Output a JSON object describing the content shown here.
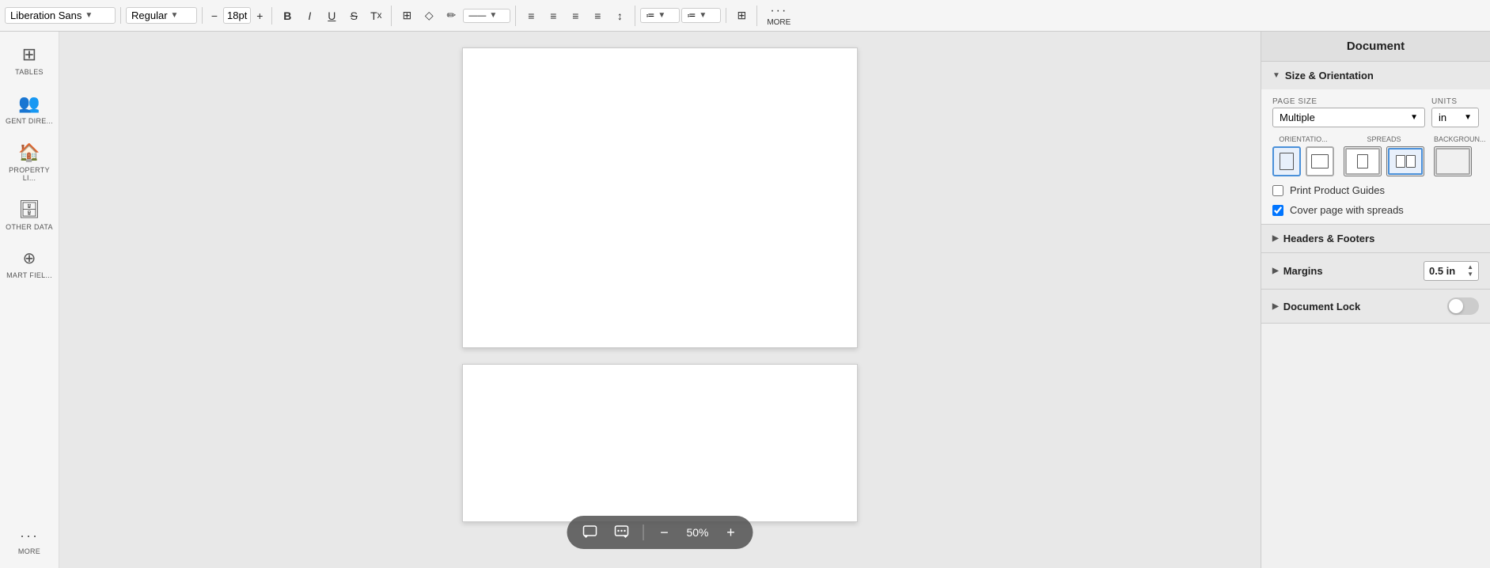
{
  "toolbar": {
    "font_name": "Liberation Sans",
    "font_style": "Regular",
    "font_size": "18pt",
    "bold": "B",
    "italic": "I",
    "underline": "U",
    "strikethrough": "S",
    "superscript": "T",
    "more_label": "MORE",
    "decrease_size": "−",
    "increase_size": "+"
  },
  "sidebar": {
    "items": [
      {
        "id": "tables",
        "icon": "⊞",
        "label": "TABLES"
      },
      {
        "id": "agent-dir",
        "icon": "👥",
        "label": "GENT DIRE..."
      },
      {
        "id": "property-li",
        "icon": "🏠",
        "label": "PROPERTY LI..."
      },
      {
        "id": "other-data",
        "icon": "🗄",
        "label": "OTHER DATA"
      },
      {
        "id": "smart-field",
        "icon": "⊕",
        "label": "MART FIEL..."
      }
    ],
    "more_label": "MORE"
  },
  "canvas": {
    "zoom_value": "50%",
    "zoom_minus": "−",
    "zoom_plus": "+"
  },
  "right_panel": {
    "title": "Document",
    "sections": [
      {
        "id": "size-orientation",
        "label": "Size & Orientation",
        "collapsed": false,
        "fields": {
          "page_size_label": "PAGE SIZE",
          "units_label": "UNITS",
          "page_size_value": "Multiple",
          "units_value": "in",
          "orientations_label": "ORIENTATIO...",
          "spreads_label": "SPREADS",
          "background_label": "BACKGROUN...",
          "print_guides_label": "Print Product Guides",
          "print_guides_checked": false,
          "cover_page_label": "Cover page with spreads",
          "cover_page_checked": true
        }
      },
      {
        "id": "headers-footers",
        "label": "Headers & Footers",
        "collapsed": true
      },
      {
        "id": "margins",
        "label": "Margins",
        "collapsed": true,
        "value": "0.5 in"
      },
      {
        "id": "document-lock",
        "label": "Document Lock",
        "collapsed": true,
        "toggle": false
      }
    ]
  }
}
